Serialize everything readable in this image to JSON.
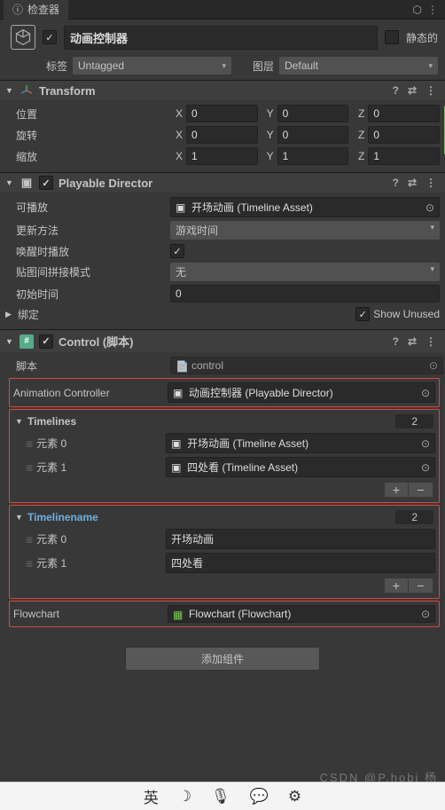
{
  "tab": {
    "title": "检查器"
  },
  "header": {
    "name": "动画控制器",
    "static_label": "静态的",
    "tag_label": "标签",
    "tag_value": "Untagged",
    "layer_label": "图层",
    "layer_value": "Default"
  },
  "transform": {
    "title": "Transform",
    "position_label": "位置",
    "rotation_label": "旋转",
    "scale_label": "缩放",
    "pos": {
      "x": "0",
      "y": "0",
      "z": "0"
    },
    "rot": {
      "x": "0",
      "y": "0",
      "z": "0"
    },
    "scl": {
      "x": "1",
      "y": "1",
      "z": "1"
    }
  },
  "director": {
    "title": "Playable Director",
    "playable_label": "可播放",
    "playable_value": "开场动画 (Timeline Asset)",
    "update_label": "更新方法",
    "update_value": "游戏时间",
    "awake_label": "唤醒时播放",
    "wrap_label": "贴图间拼接模式",
    "wrap_value": "无",
    "initial_label": "初始时间",
    "initial_value": "0",
    "bindings_label": "绑定",
    "show_unused": "Show Unused"
  },
  "control": {
    "title": "Control   (脚本)",
    "script_label": "脚本",
    "script_value": "control",
    "anim_ctrl_label": "Animation Controller",
    "anim_ctrl_value": "动画控制器 (Playable Director)",
    "timelines_label": "Timelines",
    "timelines_count": "2",
    "timelines": [
      {
        "label": "元素 0",
        "value": "开场动画 (Timeline Asset)"
      },
      {
        "label": "元素 1",
        "value": "四处看 (Timeline Asset)"
      }
    ],
    "timelinename_label": "Timelinename",
    "timelinename_count": "2",
    "timelinename": [
      {
        "label": "元素 0",
        "value": "开场动画"
      },
      {
        "label": "元素 1",
        "value": "四处看"
      }
    ],
    "flowchart_label": "Flowchart",
    "flowchart_value": "Flowchart (Flowchart)"
  },
  "add_component": "添加组件",
  "watermark": "CSDN @P.hobi 杨",
  "taskbar": {
    "ime": "英",
    "moon": "☽",
    "mic": "🎤"
  }
}
